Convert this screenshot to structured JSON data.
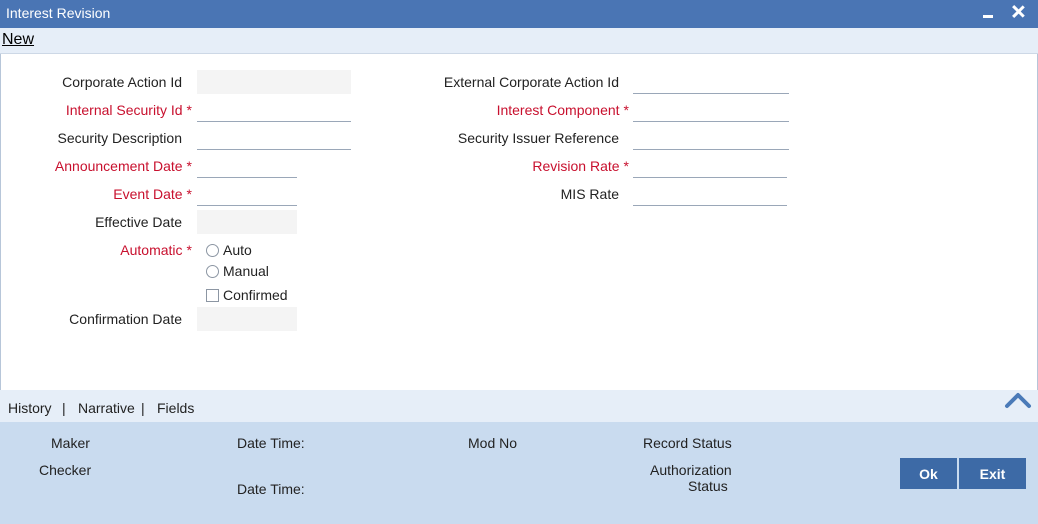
{
  "window": {
    "title": "Interest Revision"
  },
  "toolbar": {
    "new_label": "New"
  },
  "form": {
    "left": [
      {
        "label": "Corporate Action Id",
        "required": false,
        "readonly": true
      },
      {
        "label": "Internal Security Id",
        "required": true,
        "readonly": false
      },
      {
        "label": "Security Description",
        "required": false,
        "readonly": false
      },
      {
        "label": "Announcement Date",
        "required": true,
        "readonly": false
      },
      {
        "label": "Event Date",
        "required": true,
        "readonly": false
      },
      {
        "label": "Effective Date",
        "required": false,
        "readonly": true
      }
    ],
    "right": [
      {
        "label": "External Corporate Action Id",
        "required": false
      },
      {
        "label": "Interest Component",
        "required": true
      },
      {
        "label": "Security Issuer Reference",
        "required": false
      },
      {
        "label": "Revision Rate",
        "required": true
      },
      {
        "label": "MIS Rate",
        "required": false
      }
    ],
    "automatic": {
      "label": "Automatic",
      "options": [
        "Auto",
        "Manual"
      ]
    },
    "confirmed_label": "Confirmed",
    "confirmation_date_label": "Confirmation Date"
  },
  "required_mark": "*",
  "tabs": {
    "items": [
      "History",
      "Narrative",
      "Fields"
    ],
    "separator": "|"
  },
  "audit": {
    "maker": "Maker",
    "checker": "Checker",
    "date_time": "Date Time:",
    "mod_no": "Mod No",
    "record_status": "Record Status",
    "authorization_status_line1": "Authorization",
    "authorization_status_line2": "Status"
  },
  "buttons": {
    "ok": "Ok",
    "exit": "Exit"
  },
  "colors": {
    "titlebar": "#4a75b4",
    "required": "#c8102e",
    "button": "#3d6aa6",
    "audit_bg": "#c9dbef"
  },
  "icons": {
    "minimize": "minimize-icon",
    "close": "close-icon",
    "collapse": "chevron-up-icon"
  }
}
